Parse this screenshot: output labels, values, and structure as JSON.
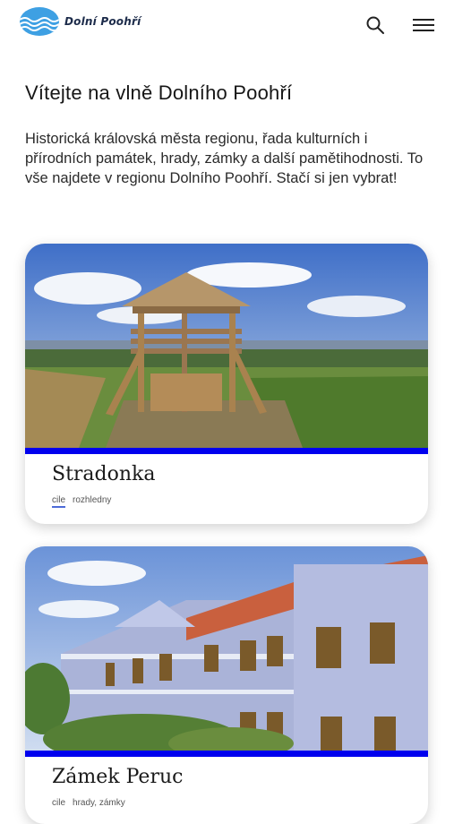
{
  "header": {
    "logo_text": "Dolní Poohří",
    "search_icon": "search-icon",
    "menu_icon": "hamburger-menu-icon"
  },
  "main": {
    "title": "Vítejte na vlně Dolního Poohří",
    "intro": "Historická královská města regionu, řada kulturních i přírodních památek, hrady, zámky a další pamětihodnosti. To vše najdete v regionu Dolního Poohří. Stačí si jen vybrat!"
  },
  "cards": [
    {
      "title": "Stradonka",
      "tags": [
        "cile",
        "rozhledny"
      ]
    },
    {
      "title": "Zámek Peruc",
      "tags": [
        "cile",
        "hrady, zámky"
      ]
    }
  ],
  "colors": {
    "accent_bar": "#0000ee",
    "logo_blue": "#3ea0e3",
    "tag_underline": "#4d6bd8"
  }
}
